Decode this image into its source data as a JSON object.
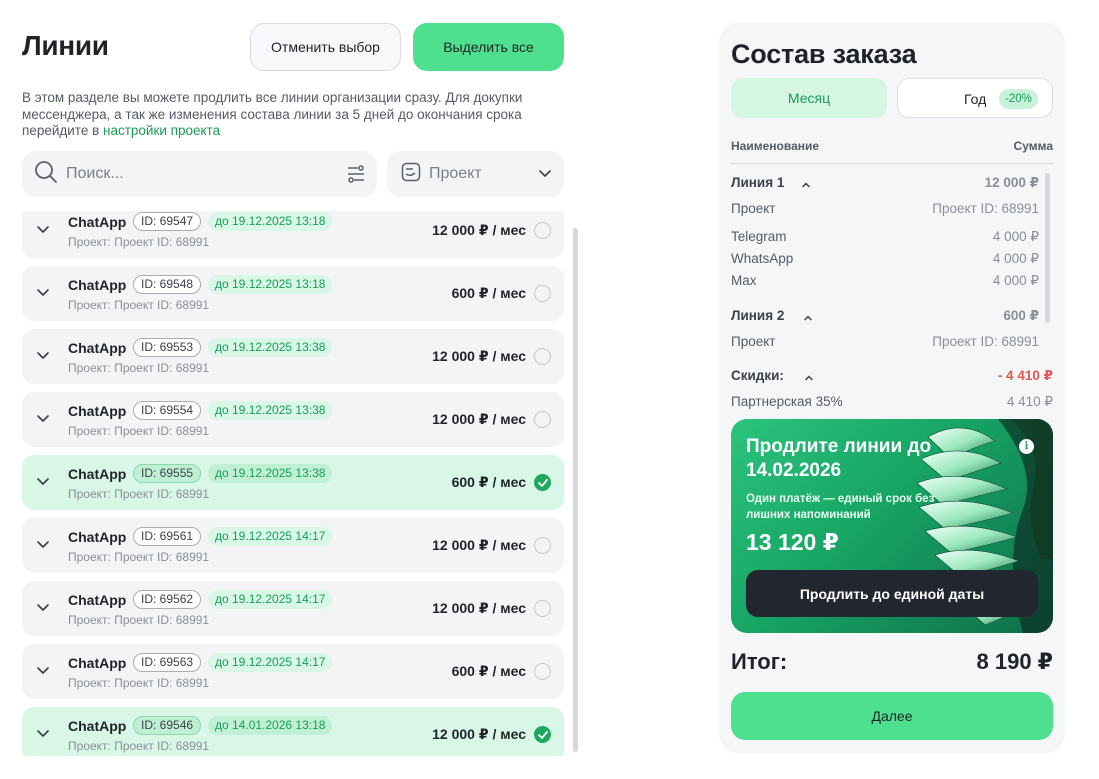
{
  "lines_section": {
    "title": "Линии",
    "cancel_label": "Отменить выбор",
    "select_all_label": "Выделить все",
    "description": "В этом разделе вы можете продлить все линии организации сразу. Для докупки мессенджера, а так же изменения состава линии за 5 дней до окончания срока перейдите в ",
    "description_link": "настройки проекта",
    "search_placeholder": "Поиск...",
    "project_filter_label": "Проект"
  },
  "lines": [
    {
      "name": "ChatApp",
      "id": "ID: 69547",
      "date": "до 19.12.2025 13:18",
      "project": "Проект: Проект ID: 68991",
      "price": "12 000 ₽ / мес",
      "selected": false
    },
    {
      "name": "ChatApp",
      "id": "ID: 69548",
      "date": "до 19.12.2025 13:18",
      "project": "Проект: Проект ID: 68991",
      "price": "600 ₽ / мес",
      "selected": false
    },
    {
      "name": "ChatApp",
      "id": "ID: 69553",
      "date": "до 19.12.2025 13:38",
      "project": "Проект: Проект ID: 68991",
      "price": "12 000 ₽ / мес",
      "selected": false
    },
    {
      "name": "ChatApp",
      "id": "ID: 69554",
      "date": "до 19.12.2025 13:38",
      "project": "Проект: Проект ID: 68991",
      "price": "12 000 ₽ / мес",
      "selected": false
    },
    {
      "name": "ChatApp",
      "id": "ID: 69555",
      "date": "до 19.12.2025 13:38",
      "project": "Проект: Проект ID: 68991",
      "price": "600 ₽ / мес",
      "selected": true
    },
    {
      "name": "ChatApp",
      "id": "ID: 69561",
      "date": "до 19.12.2025 14:17",
      "project": "Проект: Проект ID: 68991",
      "price": "12 000 ₽ / мес",
      "selected": false
    },
    {
      "name": "ChatApp",
      "id": "ID: 69562",
      "date": "до 19.12.2025 14:17",
      "project": "Проект: Проект ID: 68991",
      "price": "12 000 ₽ / мес",
      "selected": false
    },
    {
      "name": "ChatApp",
      "id": "ID: 69563",
      "date": "до 19.12.2025 14:17",
      "project": "Проект: Проект ID: 68991",
      "price": "600 ₽ / мес",
      "selected": false
    },
    {
      "name": "ChatApp",
      "id": "ID: 69546",
      "date": "до 14.01.2026 13:18",
      "project": "Проект: Проект ID: 68991",
      "price": "12 000 ₽ / мес",
      "selected": true
    }
  ],
  "order": {
    "title": "Состав заказа",
    "period_month": "Месяц",
    "period_year": "Год",
    "year_discount": "-20%",
    "col_name": "Наименование",
    "col_sum": "Сумма",
    "line1": {
      "label": "Линия 1",
      "sum": "12 000 ₽",
      "project_label": "Проект",
      "project_value": "Проект ID: 68991",
      "items": [
        {
          "name": "Telegram",
          "sum": "4 000 ₽"
        },
        {
          "name": "WhatsApp",
          "sum": "4 000 ₽"
        },
        {
          "name": "Max",
          "sum": "4 000 ₽"
        }
      ]
    },
    "line2": {
      "label": "Линия 2",
      "sum": "600 ₽",
      "project_label": "Проект",
      "project_value": "Проект ID: 68991"
    },
    "discounts": {
      "label": "Скидки:",
      "sum": "- 4 410 ₽",
      "partner_label": "Партнерская 35%",
      "partner_sum": "4 410 ₽"
    },
    "promo": {
      "title": "Продлите линии до 14.02.2026",
      "subtitle": "Один платёж — единый срок без лишних напоминаний",
      "price": "13 120 ₽",
      "button": "Продлить до единой даты",
      "info": "i"
    },
    "total_label": "Итог:",
    "total_value": "8 190 ₽",
    "next_label": "Далее"
  },
  "colors": {
    "accent": "#4ee08e",
    "accent_text": "#1a9b5a",
    "selected_row": "#d8f7e6",
    "discount_red": "#e05a55"
  }
}
